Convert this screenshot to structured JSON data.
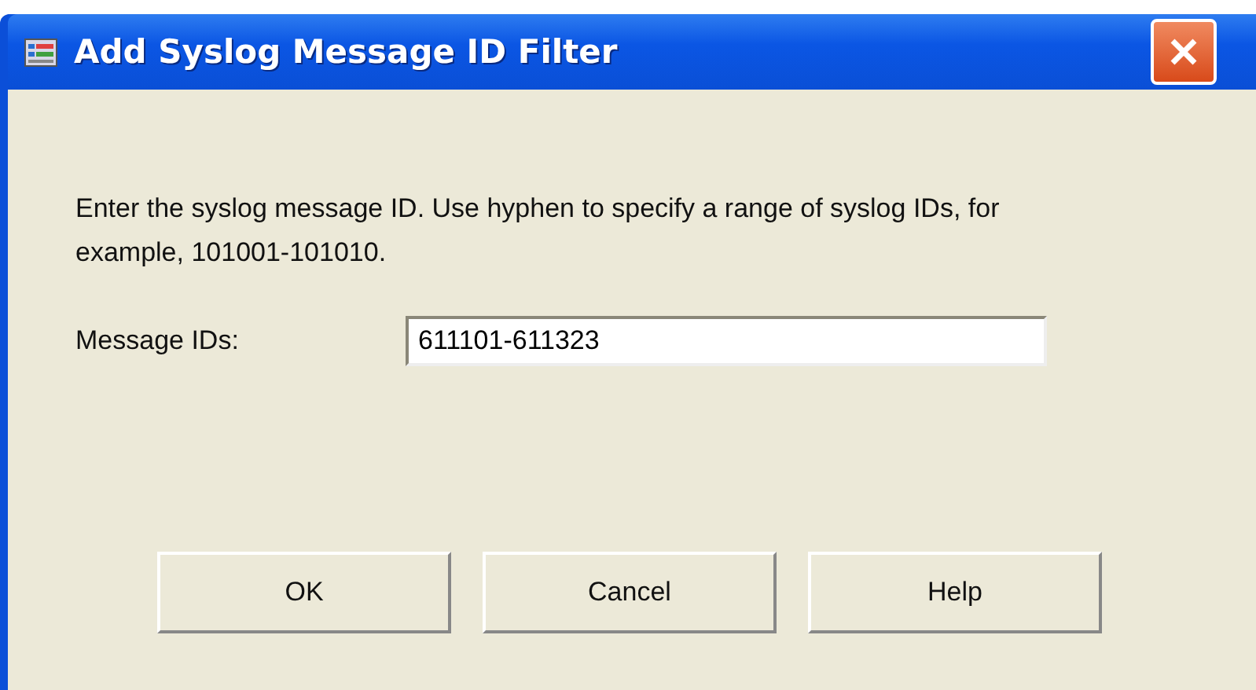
{
  "window": {
    "title": "Add Syslog Message ID Filter"
  },
  "instructions": "Enter the syslog message ID. Use hyphen to specify a range of syslog IDs, for example, 101001-101010.",
  "field": {
    "label": "Message IDs:",
    "value": "611101-611323"
  },
  "buttons": [
    "OK",
    "Cancel",
    "Help"
  ]
}
